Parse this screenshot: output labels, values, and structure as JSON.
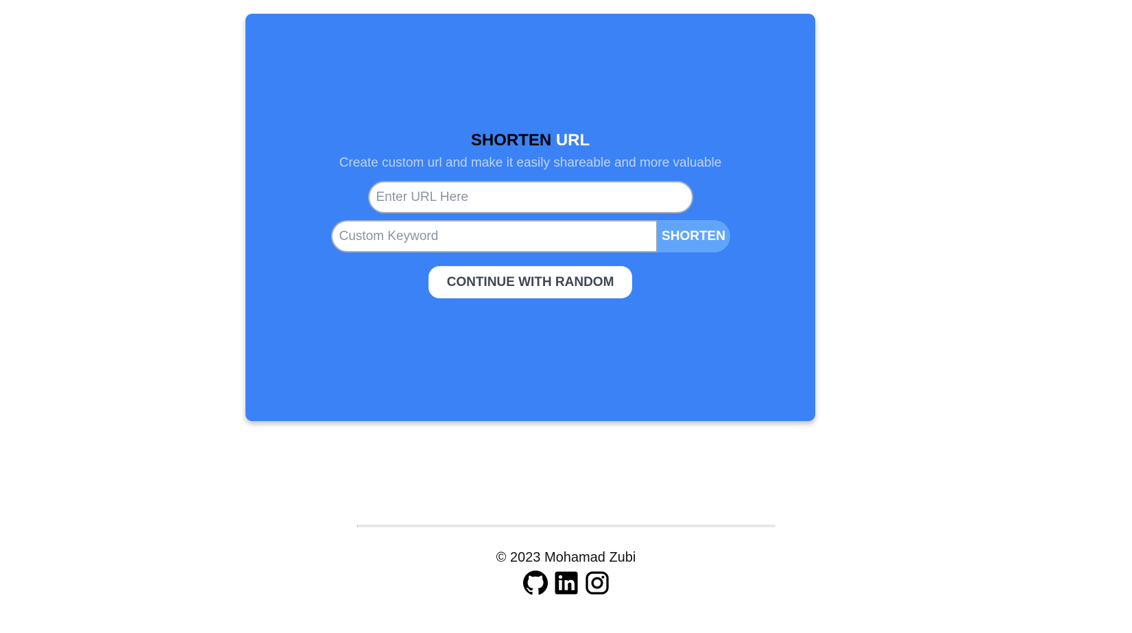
{
  "hero": {
    "title_part1": "SHORTEN",
    "title_part2": "URL",
    "subtitle": "Create custom url and make it easily shareable and more valuable"
  },
  "form": {
    "url_placeholder": "Enter URL Here",
    "url_value": "",
    "keyword_placeholder": "Custom Keyword",
    "keyword_value": "",
    "shorten_label": "SHORTEN",
    "random_label": "CONTINUE WITH RANDOM"
  },
  "footer": {
    "copyright": "© 2023 Mohamad Zubi",
    "social_icons": [
      "github-icon",
      "linkedin-icon",
      "instagram-icon"
    ]
  },
  "colors": {
    "card_background": "#3b82f6",
    "shorten_button": "#60a5fa",
    "title_accent": "#ffffff",
    "subtitle": "#bcd3fb"
  }
}
